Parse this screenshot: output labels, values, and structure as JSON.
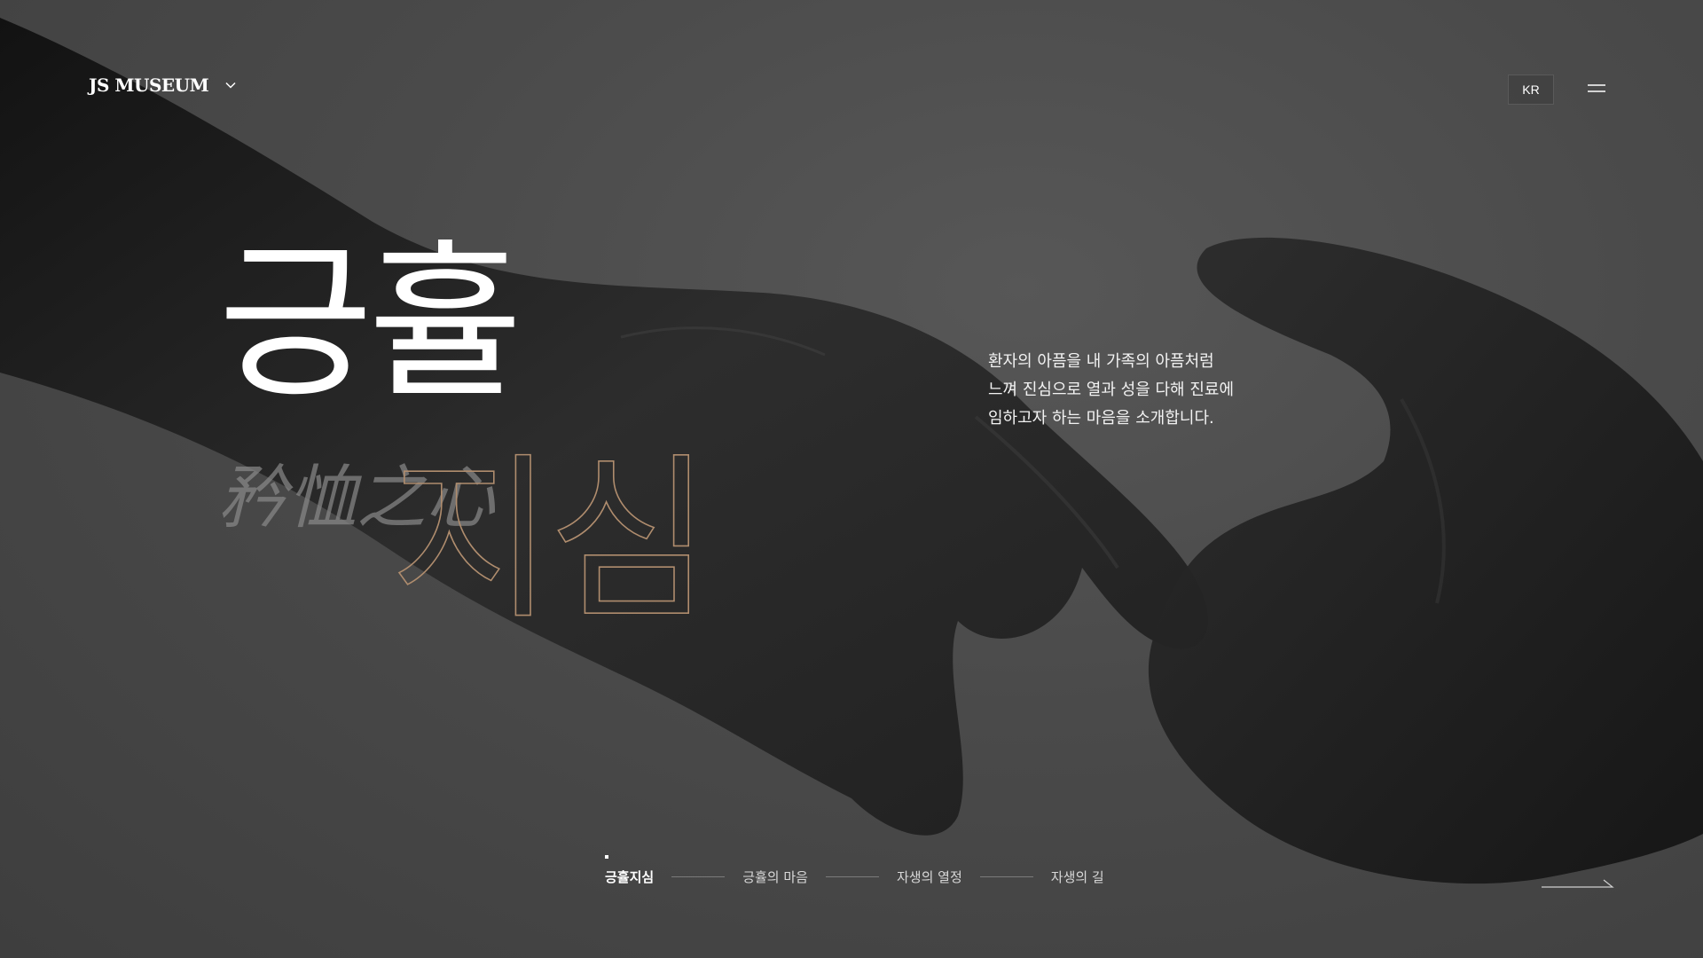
{
  "header": {
    "logo_text": "JS MUSEUM",
    "language": "KR"
  },
  "hero": {
    "title_line1": "긍휼",
    "title_line2": "지심",
    "calligraphy_text": "矜恤之心",
    "description": [
      "환자의 아픔을 내 가족의 아픔처럼",
      "느껴 진심으로 열과 성을 다해 진료에",
      "임하고자 하는 마음을 소개합니다."
    ]
  },
  "nav": {
    "items": [
      {
        "label": "긍휼지심",
        "active": true
      },
      {
        "label": "긍휼의 마음",
        "active": false
      },
      {
        "label": "자생의 열정",
        "active": false
      },
      {
        "label": "자생의 길",
        "active": false
      }
    ]
  },
  "icons": {
    "logo_dropdown": "chevron-down-icon",
    "menu": "hamburger-menu-icon",
    "next": "arrow-right-icon"
  },
  "colors": {
    "background": "#464646",
    "title_outline": "#b08d6e",
    "text": "#ffffff"
  }
}
